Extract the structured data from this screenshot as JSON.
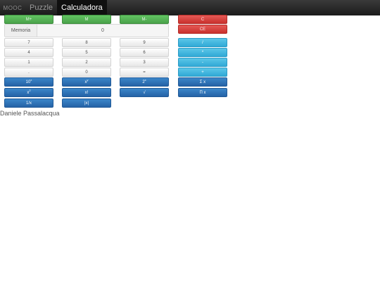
{
  "navbar": {
    "brand": "MOOC",
    "items": [
      {
        "label": "Puzzle",
        "active": false
      },
      {
        "label": "Calculadora",
        "active": true
      }
    ]
  },
  "memory": {
    "label": "Memoria",
    "value": "0",
    "buttons": [
      "M+",
      "M",
      "M-"
    ]
  },
  "clear": {
    "c": "C",
    "ce": "CE"
  },
  "keypad": {
    "digits": [
      "7",
      "8",
      "9",
      "4",
      "5",
      "6",
      "1",
      "2",
      "3"
    ],
    "decimal": ".",
    "zero": "0",
    "equals": "="
  },
  "operators": [
    "/",
    "*",
    "-",
    "+"
  ],
  "functions": {
    "ten_pow": {
      "base": "10",
      "exp": "x"
    },
    "x_pow_y": {
      "base": "x",
      "exp": "y"
    },
    "two_pow": {
      "base": "2",
      "exp": "x"
    },
    "x_sq": {
      "base": "x",
      "exp": "2"
    },
    "factorial": "x!",
    "sqrt": "√",
    "sum": "Σ x",
    "product": "Π x",
    "inverse": "1/x",
    "abs": "|x|"
  },
  "colors": {
    "navbar": "#222222",
    "success": "#5bb75b",
    "danger": "#da4f49",
    "info": "#49afcd",
    "primary": "#2f6fb5"
  },
  "footer": {
    "author": "Daniele Passalacqua"
  }
}
